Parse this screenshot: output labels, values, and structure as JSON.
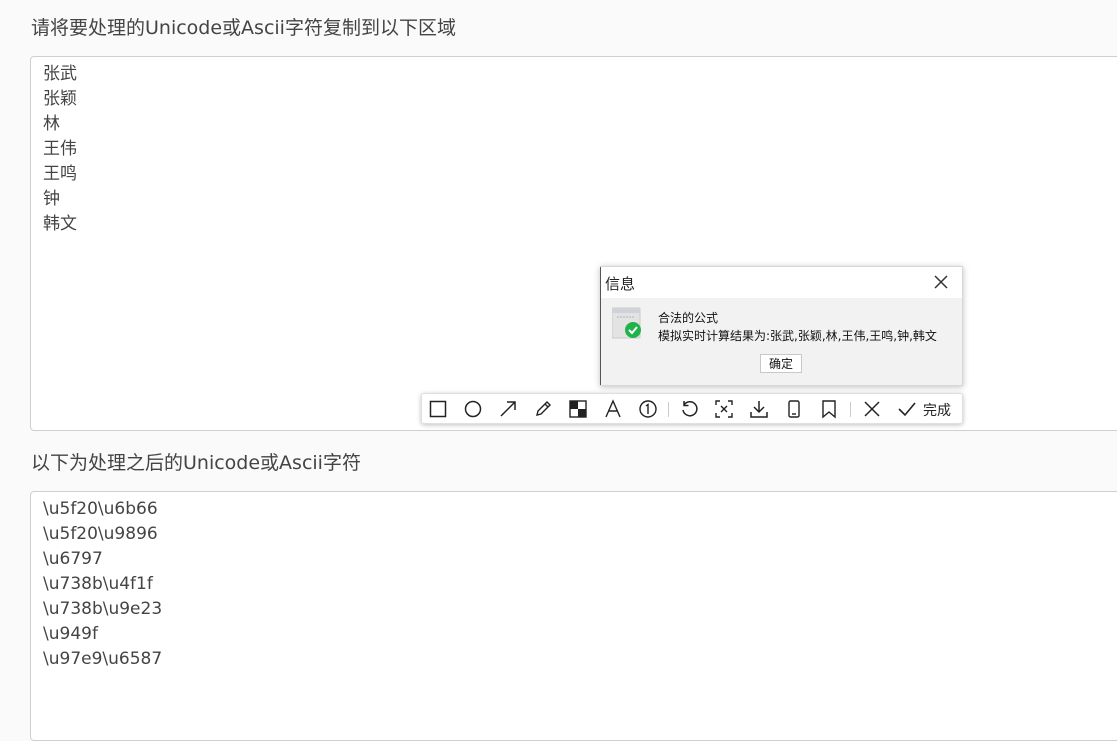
{
  "input_section": {
    "title": "请将要处理的Unicode或Ascii字符复制到以下区域",
    "lines": [
      "张武",
      "张颖",
      "林",
      "王伟",
      "王鸣",
      "钟",
      "韩文"
    ]
  },
  "output_section": {
    "title": "以下为处理之后的Unicode或Ascii字符",
    "lines": [
      "\\u5f20\\u6b66",
      "\\u5f20\\u9896",
      "\\u6797",
      "\\u738b\\u4f1f",
      "\\u738b\\u9e23",
      "\\u949f",
      "\\u97e9\\u6587"
    ]
  },
  "dialog": {
    "title": "信息",
    "message_line1": "合法的公式",
    "message_line2": "模拟实时计算结果为:张武,张颖,林,王伟,王鸣,钟,韩文",
    "ok_label": "确定"
  },
  "toolbar": {
    "done_label": "完成"
  },
  "icons": {
    "dialog": "success-check-icon",
    "close": "close-icon"
  },
  "colors": {
    "success": "#1fb34a"
  }
}
